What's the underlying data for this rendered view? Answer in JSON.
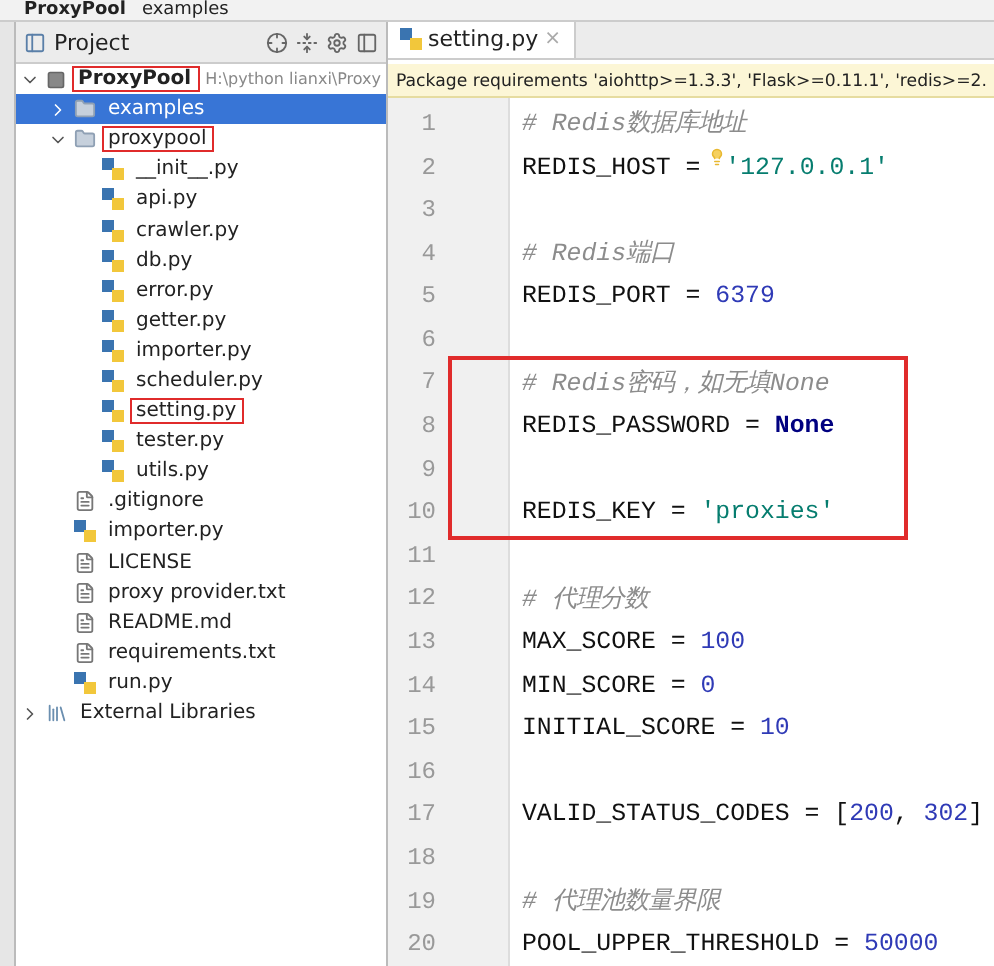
{
  "breadcrumb": [
    {
      "label": "ProxyPool",
      "kind": "project"
    },
    {
      "label": "examples",
      "kind": "folder"
    }
  ],
  "project_panel": {
    "title": "Project",
    "tree": [
      {
        "label": "ProxyPool",
        "path": "H:\\python lianxi\\Proxy",
        "kind": "project",
        "expanded": true,
        "selected": false,
        "annotated": true,
        "children": [
          {
            "label": "examples",
            "kind": "folder",
            "expanded": false,
            "selected": true,
            "annotated": false
          },
          {
            "label": "proxypool",
            "kind": "folder",
            "expanded": true,
            "selected": false,
            "annotated": true,
            "children": [
              {
                "label": "__init__.py",
                "kind": "python",
                "selected": false,
                "annotated": false
              },
              {
                "label": "api.py",
                "kind": "python",
                "selected": false,
                "annotated": false
              },
              {
                "label": "crawler.py",
                "kind": "python",
                "selected": false,
                "annotated": false
              },
              {
                "label": "db.py",
                "kind": "python",
                "selected": false,
                "annotated": false
              },
              {
                "label": "error.py",
                "kind": "python",
                "selected": false,
                "annotated": false
              },
              {
                "label": "getter.py",
                "kind": "python",
                "selected": false,
                "annotated": false
              },
              {
                "label": "importer.py",
                "kind": "python",
                "selected": false,
                "annotated": false
              },
              {
                "label": "scheduler.py",
                "kind": "python",
                "selected": false,
                "annotated": false
              },
              {
                "label": "setting.py",
                "kind": "python",
                "selected": false,
                "annotated": true
              },
              {
                "label": "tester.py",
                "kind": "python",
                "selected": false,
                "annotated": false
              },
              {
                "label": "utils.py",
                "kind": "python",
                "selected": false,
                "annotated": false
              }
            ]
          },
          {
            "label": ".gitignore",
            "kind": "file",
            "selected": false,
            "annotated": false
          },
          {
            "label": "importer.py",
            "kind": "python",
            "selected": false,
            "annotated": false
          },
          {
            "label": "LICENSE",
            "kind": "file",
            "selected": false,
            "annotated": false
          },
          {
            "label": "proxy provider.txt",
            "kind": "file",
            "selected": false,
            "annotated": false
          },
          {
            "label": "README.md",
            "kind": "file",
            "selected": false,
            "annotated": false
          },
          {
            "label": "requirements.txt",
            "kind": "file",
            "selected": false,
            "annotated": false
          },
          {
            "label": "run.py",
            "kind": "python",
            "selected": false,
            "annotated": false
          }
        ]
      },
      {
        "label": "External Libraries",
        "kind": "library",
        "expanded": false,
        "selected": false,
        "annotated": false
      }
    ]
  },
  "editor": {
    "tabs": [
      {
        "label": "setting.py",
        "close": "×",
        "selected": true
      }
    ],
    "banner": "Package requirements 'aiohttp>=1.3.3', 'Flask>=0.11.1', 'redis>=2.",
    "lines": [
      {
        "number": "1",
        "annotated": false,
        "tokens": [
          {
            "kind": "comment",
            "text": "# Redis数据库地址"
          }
        ]
      },
      {
        "number": "2",
        "annotated": false,
        "tokens": [
          {
            "kind": "plain",
            "text": "REDIS_HOST = "
          },
          {
            "kind": "string",
            "text": "'127.0.0.1'"
          }
        ]
      },
      {
        "number": "3",
        "annotated": false
      },
      {
        "number": "4",
        "annotated": false,
        "tokens": [
          {
            "kind": "comment",
            "text": "# Redis端口"
          }
        ]
      },
      {
        "number": "5",
        "annotated": false,
        "tokens": [
          {
            "kind": "plain",
            "text": "REDIS_PORT = "
          },
          {
            "kind": "number",
            "text": "6379"
          }
        ]
      },
      {
        "number": "6",
        "annotated": false
      },
      {
        "number": "7",
        "annotated": true,
        "tokens": [
          {
            "kind": "comment",
            "text": "# Redis密码，如无填None"
          }
        ]
      },
      {
        "number": "8",
        "annotated": true,
        "tokens": [
          {
            "kind": "plain",
            "text": "REDIS_PASSWORD = "
          },
          {
            "kind": "keyword",
            "text": "None"
          }
        ]
      },
      {
        "number": "9",
        "annotated": true
      },
      {
        "number": "10",
        "annotated": true,
        "tokens": [
          {
            "kind": "plain",
            "text": "REDIS_KEY = "
          },
          {
            "kind": "string",
            "text": "'proxies'"
          }
        ]
      },
      {
        "number": "11",
        "annotated": false
      },
      {
        "number": "12",
        "annotated": false,
        "tokens": [
          {
            "kind": "comment",
            "text": "# 代理分数"
          }
        ]
      },
      {
        "number": "13",
        "annotated": false,
        "tokens": [
          {
            "kind": "plain",
            "text": "MAX_SCORE = "
          },
          {
            "kind": "number",
            "text": "100"
          }
        ]
      },
      {
        "number": "14",
        "annotated": false,
        "tokens": [
          {
            "kind": "plain",
            "text": "MIN_SCORE = "
          },
          {
            "kind": "number",
            "text": "0"
          }
        ]
      },
      {
        "number": "15",
        "annotated": false,
        "tokens": [
          {
            "kind": "plain",
            "text": "INITIAL_SCORE = "
          },
          {
            "kind": "number",
            "text": "10"
          }
        ]
      },
      {
        "number": "16",
        "annotated": false
      },
      {
        "number": "17",
        "annotated": false,
        "tokens": [
          {
            "kind": "plain",
            "text": "VALID_STATUS_CODES = ["
          },
          {
            "kind": "number",
            "text": "200"
          },
          {
            "kind": "plain",
            "text": ", "
          },
          {
            "kind": "number",
            "text": "302"
          },
          {
            "kind": "plain",
            "text": "]"
          }
        ]
      },
      {
        "number": "18",
        "annotated": false
      },
      {
        "number": "19",
        "annotated": false,
        "tokens": [
          {
            "kind": "comment",
            "text": "# 代理池数量界限"
          }
        ]
      },
      {
        "number": "20",
        "annotated": false,
        "tokens": [
          {
            "kind": "plain",
            "text": "POOL_UPPER_THRESHOLD = "
          },
          {
            "kind": "number",
            "text": "50000"
          }
        ]
      }
    ]
  }
}
